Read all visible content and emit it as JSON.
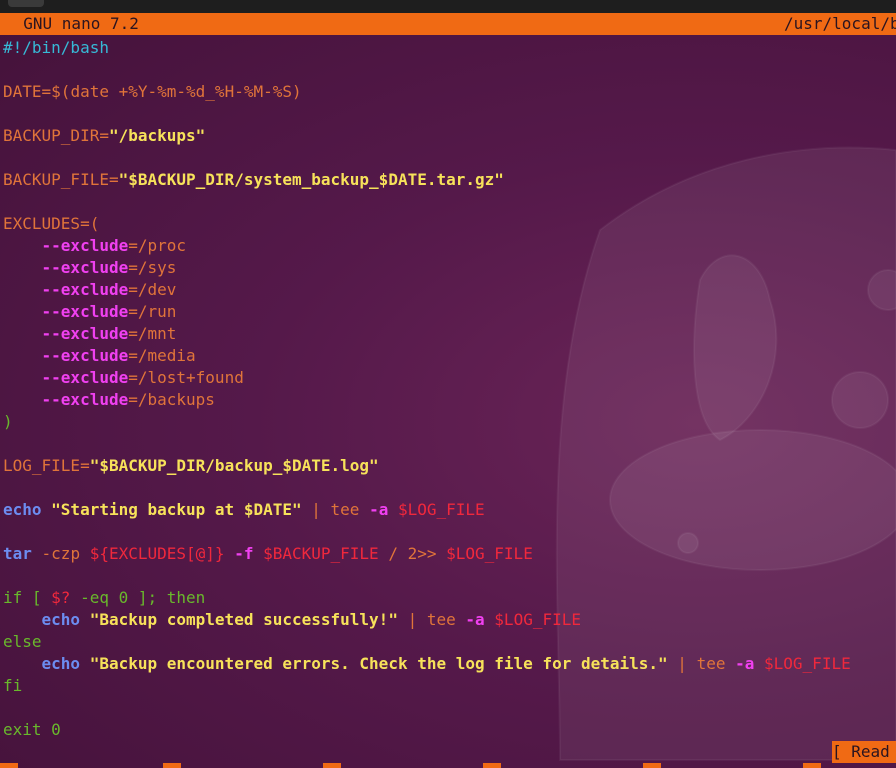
{
  "app": {
    "title_left": "  GNU nano 7.2",
    "title_right": "/usr/local/b"
  },
  "status": {
    "message": "[ Read"
  },
  "colors": {
    "title_bar": "#f06a14",
    "background": "#4a1738",
    "comment": "#37b9d6",
    "string": "#f7e25a",
    "option": "#f040f0",
    "keyword": "#6c8cf0",
    "variable": "#f0283c",
    "control": "#69b82c",
    "plain": "#e0743a"
  },
  "code": {
    "l1": "#!/bin/bash",
    "l3a": "DATE=",
    "l3b": "$(date +%Y-%m-%d_%H-%M-%S)",
    "l5a": "BACKUP_DIR=",
    "l5b": "\"/backups\"",
    "l7a": "BACKUP_FILE=",
    "l7b": "\"$BACKUP_DIR/system_backup_$DATE.tar.gz\"",
    "l9": "EXCLUDES=(",
    "ex_indent": "    ",
    "ex_opt": "--exclude",
    "ex1": "=/proc",
    "ex2": "=/sys",
    "ex3": "=/dev",
    "ex4": "=/run",
    "ex5": "=/mnt",
    "ex6": "=/media",
    "ex7": "=/lost+found",
    "ex8": "=/backups",
    "l18": ")",
    "l20a": "LOG_FILE=",
    "l20b": "\"$BACKUP_DIR/backup_$DATE.log\"",
    "echo": "echo",
    "l22b": " \"Starting backup at $DATE\"",
    "pipe_tee": " | tee ",
    "opt_a": "-a",
    "sp": " ",
    "logvar": "$LOG_FILE",
    "tar": "tar",
    "l24b": " -czp ",
    "l24c": "${EXCLUDES[@]}",
    "l24d": " -f ",
    "l24e": "$BACKUP_FILE",
    "l24f": " / 2>> ",
    "l26a": "if [ ",
    "l26b": "$?",
    "l26c": " -eq 0 ]; then",
    "indent": "    ",
    "l27b": " \"Backup completed successfully!\"",
    "l28": "else",
    "l29b": " \"Backup encountered errors. Check the log file for details.\"",
    "l30": "fi",
    "l32": "exit 0"
  }
}
